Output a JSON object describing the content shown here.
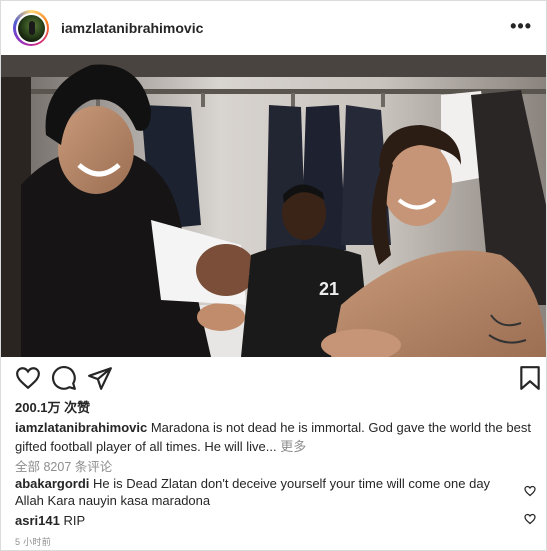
{
  "post": {
    "username": "iamzlatanibrahimovic",
    "likes": "200.1万 次赞",
    "caption_user": "iamzlatanibrahimovic",
    "caption_text": "Maradona is not dead he is immortal. God gave the world the best gifted football player of all times. He will live...",
    "caption_more": "更多",
    "view_all": "全部 8207 条评论",
    "time": "5 小时前",
    "photo_jersey_number": "21"
  },
  "comments": [
    {
      "user": "abakargordi",
      "text": "He is Dead Zlatan don't deceive yourself your time will come one day Allah Kara nauyin kasa maradona"
    },
    {
      "user": "asri141",
      "text": "RIP"
    }
  ],
  "icons": {
    "more": "more-options-icon",
    "like": "heart-icon",
    "comment": "comment-icon",
    "share": "share-icon",
    "save": "bookmark-icon"
  },
  "colors": {
    "text": "#262626",
    "muted": "#8e8e8e",
    "border": "#dbdbdb"
  }
}
